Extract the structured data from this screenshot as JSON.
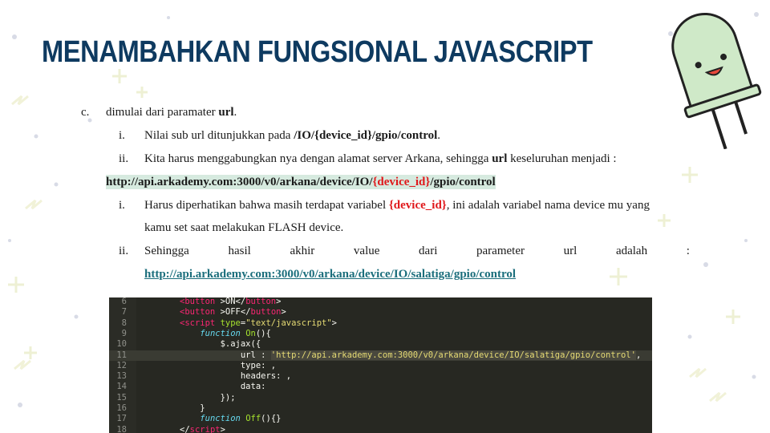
{
  "title": "MENAMBAHKAN FUNGSIONAL JAVASCRIPT",
  "colors": {
    "title": "#0e3a60",
    "highlight": "#e0181b",
    "link": "#1b6e7c",
    "code_bg": "#272822"
  },
  "items": [
    {
      "marker": "c.",
      "text": [
        "dimulai dari paramater ",
        "url",
        "."
      ]
    },
    {
      "marker": "i.",
      "text": [
        "Nilai sub url ditunjukkan pada ",
        "/IO/{device_id}/gpio/control",
        "."
      ]
    },
    {
      "marker": "ii.",
      "text": [
        "Kita harus menggabungkan nya dengan alamat server Arkana, sehingga ",
        "url",
        " keseluruhan menjadi :"
      ]
    },
    {
      "marker": "",
      "text": [
        "http://api.arkademy.com:3000/v0/arkana/device/IO/",
        "{device_id}",
        "/gpio/control"
      ]
    },
    {
      "marker": "i.",
      "text": [
        "Harus diperhatikan bahwa masih terdapat variabel ",
        "{device_id}",
        ", ini adalah variabel nama device mu yang"
      ]
    },
    {
      "marker": "",
      "text": [
        "kamu set saat melakukan FLASH device."
      ]
    },
    {
      "marker": "ii.",
      "words": [
        "Sehingga",
        "hasil",
        "akhir",
        "value",
        "dari",
        "parameter",
        "url",
        "adalah",
        ":"
      ]
    },
    {
      "marker": "",
      "link": "http://api.arkademy.com:3000/v0/arkana/device/IO/salatiga/gpio/control"
    }
  ],
  "code": {
    "lines": [
      {
        "n": "6",
        "parts": [
          [
            "tag",
            "<"
          ],
          [
            "tag",
            "button"
          ],
          [
            "plain",
            " >ON</"
          ],
          [
            "tag",
            "button"
          ],
          [
            "plain",
            ">"
          ]
        ]
      },
      {
        "n": "7",
        "parts": [
          [
            "tag",
            "<"
          ],
          [
            "tag",
            "button"
          ],
          [
            "plain",
            " >OFF</"
          ],
          [
            "tag",
            "button"
          ],
          [
            "plain",
            ">"
          ]
        ]
      },
      {
        "n": "8",
        "parts": [
          [
            "tag",
            "<script"
          ],
          [
            "attr",
            " type"
          ],
          [
            "plain",
            "="
          ],
          [
            "str",
            "\"text/javascript\""
          ],
          [
            "plain",
            ">"
          ]
        ]
      },
      {
        "n": "9",
        "indent": "    ",
        "parts": [
          [
            "kw",
            "function"
          ],
          [
            "fn",
            " On"
          ],
          [
            "plain",
            "(){"
          ]
        ]
      },
      {
        "n": "10",
        "indent": "        ",
        "parts": [
          [
            "plain",
            "$.ajax({"
          ]
        ]
      },
      {
        "n": "11",
        "indent": "            ",
        "parts": [
          [
            "plain",
            "url : "
          ],
          [
            "strhl",
            "'http://api.arkademy.com:3000/v0/arkana/device/IO/salatiga/gpio/control'"
          ],
          [
            "plain",
            ","
          ]
        ]
      },
      {
        "n": "12",
        "indent": "            ",
        "parts": [
          [
            "plain",
            "type: ,"
          ]
        ]
      },
      {
        "n": "13",
        "indent": "            ",
        "parts": [
          [
            "plain",
            "headers: ,"
          ]
        ]
      },
      {
        "n": "14",
        "indent": "            ",
        "parts": [
          [
            "plain",
            "data:"
          ]
        ]
      },
      {
        "n": "15",
        "indent": "        ",
        "parts": [
          [
            "plain",
            "});"
          ]
        ]
      },
      {
        "n": "16",
        "indent": "    ",
        "parts": [
          [
            "plain",
            "}"
          ]
        ]
      },
      {
        "n": "17",
        "indent": "    ",
        "parts": [
          [
            "kw",
            "function"
          ],
          [
            "fn",
            " Off"
          ],
          [
            "plain",
            "(){}"
          ]
        ]
      },
      {
        "n": "18",
        "parts": [
          [
            "plain",
            "</"
          ],
          [
            "tag",
            "script"
          ],
          [
            "plain",
            ">"
          ]
        ]
      }
    ]
  }
}
